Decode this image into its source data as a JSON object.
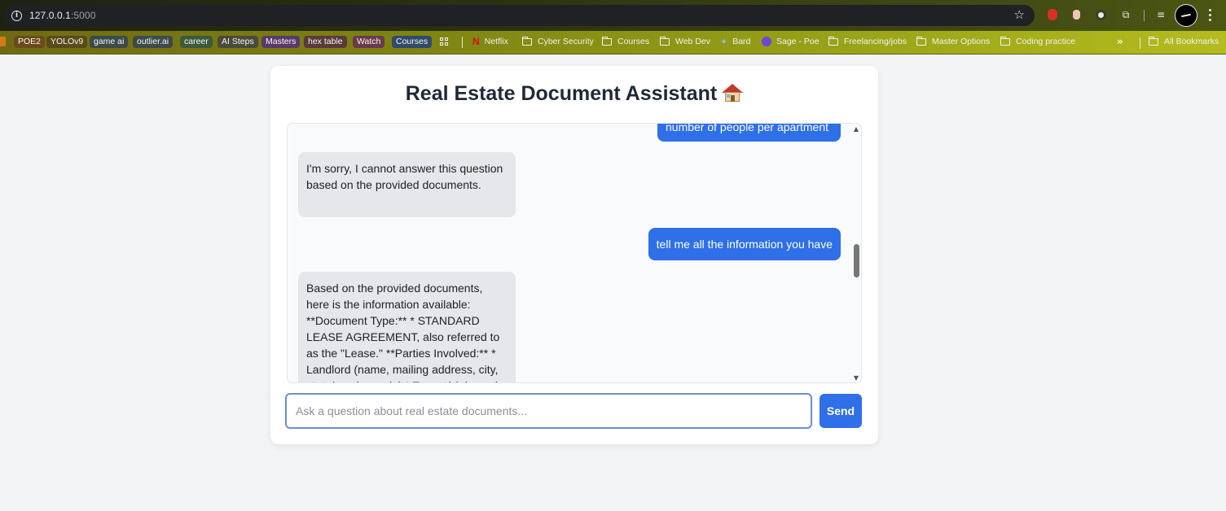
{
  "browser": {
    "url_host": "127.0.0.1",
    "url_port": ":5000"
  },
  "bookmarks": {
    "chips": [
      {
        "label": "POE2",
        "color": "#6b4a1a"
      },
      {
        "label": "YOLOv9",
        "color": "#5a4a1a"
      },
      {
        "label": "game ai",
        "color": "#3d4a4a"
      },
      {
        "label": "outlier.ai",
        "color": "#3d4a4a"
      },
      {
        "label": "career",
        "color": "#3d5a3a"
      },
      {
        "label": "AI Steps",
        "color": "#4a4a3a"
      },
      {
        "label": "Masters",
        "color": "#5a3a6a"
      },
      {
        "label": "hex table",
        "color": "#5a3a3a"
      },
      {
        "label": "Watch",
        "color": "#6a3a4a"
      },
      {
        "label": "Courses",
        "color": "#2f4a6a"
      }
    ],
    "links": [
      {
        "label": "Netflix"
      },
      {
        "label": "Cyber Security"
      },
      {
        "label": "Courses"
      },
      {
        "label": "Web Dev"
      },
      {
        "label": "Bard"
      },
      {
        "label": "Sage - Poe"
      },
      {
        "label": "Freelancing/jobs"
      },
      {
        "label": "Master Options"
      },
      {
        "label": "Coding practice"
      }
    ],
    "all_bookmarks": "All Bookmarks"
  },
  "app": {
    "title": "Real Estate Document Assistant",
    "accent_color": "#2f6fe8",
    "messages": [
      {
        "role": "user",
        "text": "number of people per apartment"
      },
      {
        "role": "bot",
        "text": "I'm sorry, I cannot answer this question based on the provided documents."
      },
      {
        "role": "user",
        "text": "tell me all the information you have"
      },
      {
        "role": "bot",
        "text": "Based on the provided documents, here is the information available: **Document Type:** * STANDARD LEASE AGREEMENT, also referred to as the \"Lease.\" **Parties Involved:** * Landlord (name, mailing address, city, state/province, zip)  * Tenant(s) (name)"
      }
    ],
    "input_placeholder": "Ask a question about real estate documents...",
    "input_value": "",
    "send_label": "Send"
  }
}
